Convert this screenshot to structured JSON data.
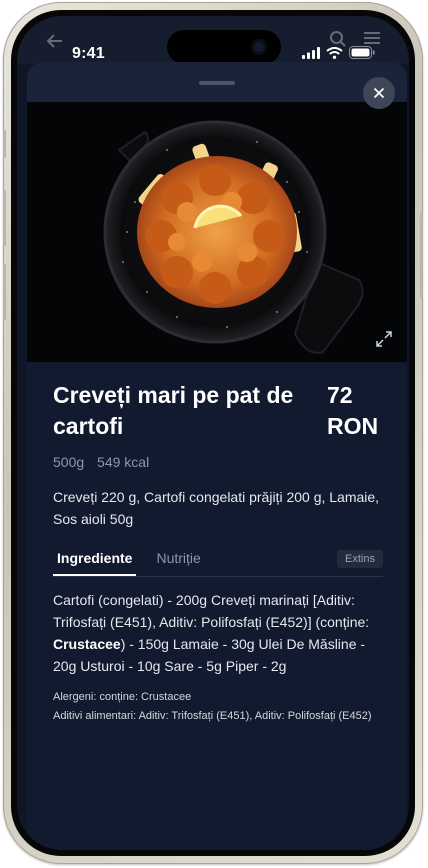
{
  "status_bar": {
    "time": "9:41"
  },
  "product": {
    "title": "Creveți mari pe pat de cartofi",
    "price": "72 RON",
    "weight": "500g",
    "calories": "549 kcal",
    "description": "Creveți 220 g, Cartofi congelati prăjiți 200 g, Lamaie, Sos aioli 50g"
  },
  "tabs": [
    {
      "label": "Ingrediente",
      "active": true
    },
    {
      "label": "Nutriție",
      "active": false
    }
  ],
  "extins_label": "Extins",
  "ingredients": {
    "part1": "Cartofi (congelati) - 200g Creveți marinați [Aditiv: Trifosfați (E451), Aditiv: Polifosfați (E452)] (conține: ",
    "allergen_bold": "Crustacee",
    "part2": ") - 150g Lamaie - 30g Ulei De Măsline - 20g Usturoi - 10g Sare - 5g Piper - 2g"
  },
  "allergens_text": "Alergeni: conține: Crustacee",
  "additives_text": "Aditivi alimentari: Aditiv: Trifosfați (E451), Aditiv: Polifosfați (E452)",
  "icons": {
    "close": "close-icon",
    "expand": "expand-icon",
    "signal": "signal-icon",
    "wifi": "wifi-icon",
    "battery": "battery-icon"
  }
}
